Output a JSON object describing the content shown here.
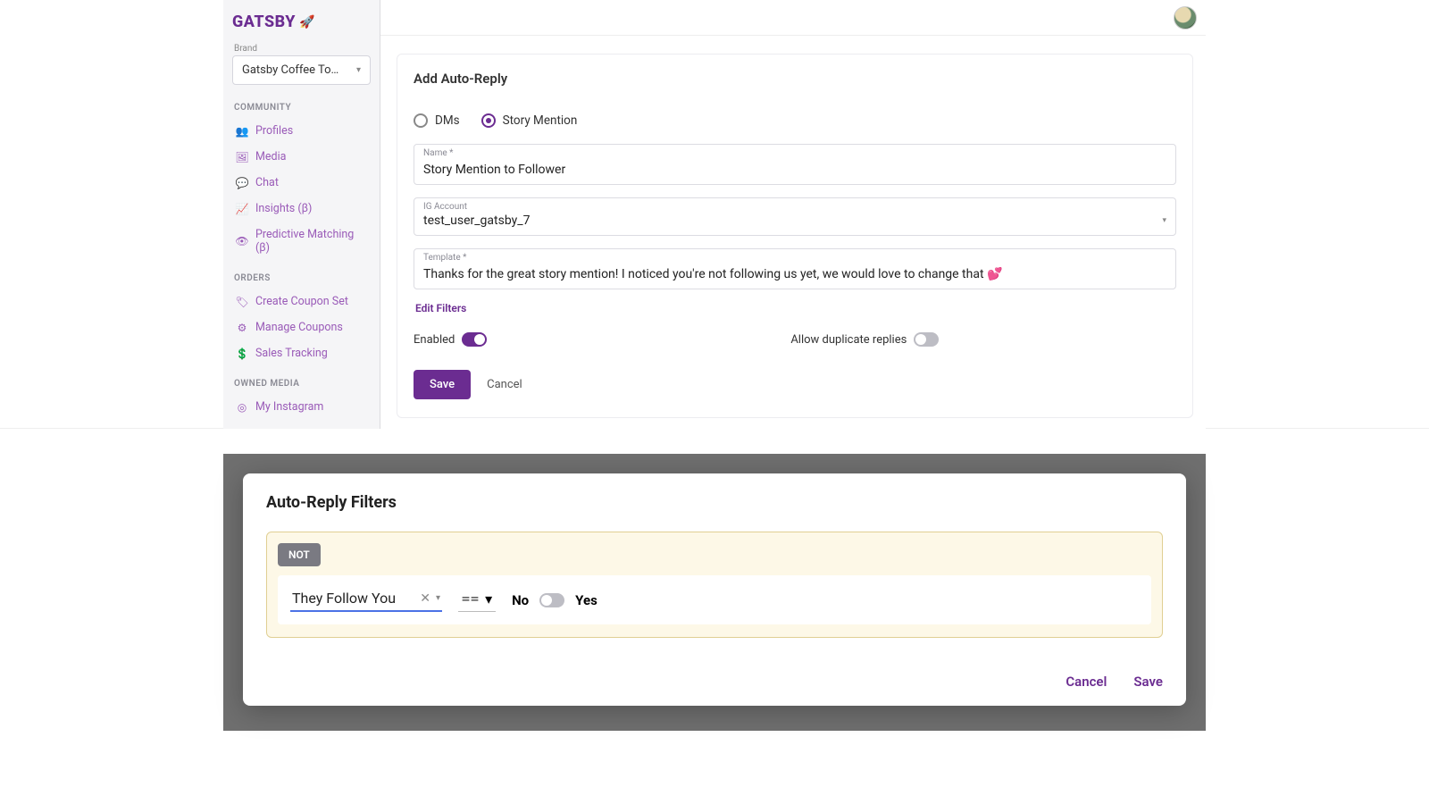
{
  "brand": {
    "logo": "GATSBY",
    "logo_emoji": "🚀",
    "label": "Brand",
    "selected": "Gatsby Coffee To…"
  },
  "sidebar": {
    "sections": {
      "community": {
        "label": "COMMUNITY",
        "items": [
          {
            "icon": "profiles-icon",
            "glyph": "👥",
            "label": "Profiles"
          },
          {
            "icon": "media-icon",
            "glyph": "🖼",
            "label": "Media"
          },
          {
            "icon": "chat-icon",
            "glyph": "💬",
            "label": "Chat"
          },
          {
            "icon": "insights-icon",
            "glyph": "📈",
            "label": "Insights (β)"
          },
          {
            "icon": "predictive-icon",
            "glyph": "👁",
            "label": "Predictive Matching (β)"
          }
        ]
      },
      "orders": {
        "label": "ORDERS",
        "items": [
          {
            "icon": "coupon-create-icon",
            "glyph": "🏷",
            "label": "Create Coupon Set"
          },
          {
            "icon": "coupon-manage-icon",
            "glyph": "⚙",
            "label": "Manage Coupons"
          },
          {
            "icon": "sales-icon",
            "glyph": "💲",
            "label": "Sales Tracking"
          }
        ]
      },
      "owned": {
        "label": "OWNED MEDIA",
        "items": [
          {
            "icon": "instagram-icon",
            "glyph": "◎",
            "label": "My Instagram"
          }
        ]
      }
    }
  },
  "form": {
    "title": "Add Auto-Reply",
    "radio_dms": "DMs",
    "radio_story": "Story Mention",
    "selected_radio": "story",
    "name_label": "Name *",
    "name_value": "Story Mention to Follower",
    "ig_label": "IG Account",
    "ig_value": "test_user_gatsby_7",
    "template_label": "Template *",
    "template_value": "Thanks for the great story mention! I noticed you're not following us yet, we would love to change that 💕",
    "edit_filters": "Edit Filters",
    "enabled_label": "Enabled",
    "enabled_on": true,
    "dup_label": "Allow duplicate replies",
    "dup_on": false,
    "save": "Save",
    "cancel": "Cancel"
  },
  "modal": {
    "title": "Auto-Reply Filters",
    "not_chip": "NOT",
    "rule_field": "They Follow You",
    "rule_op": "==",
    "bool_no": "No",
    "bool_yes": "Yes",
    "bool_value": false,
    "cancel": "Cancel",
    "save": "Save"
  }
}
